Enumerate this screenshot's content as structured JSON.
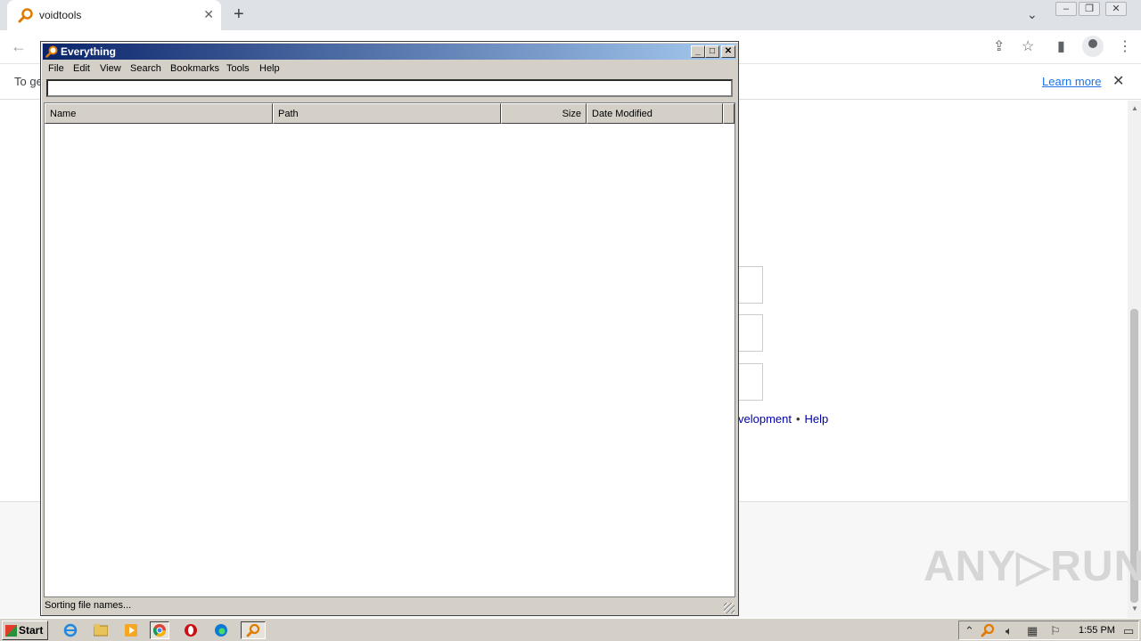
{
  "browser": {
    "tab_title": "voidtools",
    "infobar_text": "To ge",
    "learn_more": "Learn more"
  },
  "page": {
    "links": [
      "velopment",
      "Help"
    ],
    "link_separator": "•",
    "watermark": "ANY▷RUN"
  },
  "everything_window": {
    "title": "Everything",
    "menus": [
      "File",
      "Edit",
      "View",
      "Search",
      "Bookmarks",
      "Tools",
      "Help"
    ],
    "search_value": "",
    "columns": [
      "Name",
      "Path",
      "Size",
      "Date Modified"
    ],
    "status": "Sorting file names..."
  },
  "taskbar": {
    "start_label": "Start",
    "clock": "1:55 PM"
  },
  "icons": {
    "tab_favicon": "everything-magnifier-icon",
    "close": "close-icon",
    "new_tab": "plus-icon",
    "back": "back-arrow-icon",
    "share": "share-icon",
    "bookmark": "star-icon",
    "side_panel": "side-panel-icon",
    "profile": "profile-icon",
    "menu": "kebab-menu-icon"
  },
  "colors": {
    "title_gradient_start": "#0a246a",
    "title_gradient_end": "#a6caf0",
    "window_face": "#d4d0c8",
    "link_blue": "#1a73e8"
  }
}
